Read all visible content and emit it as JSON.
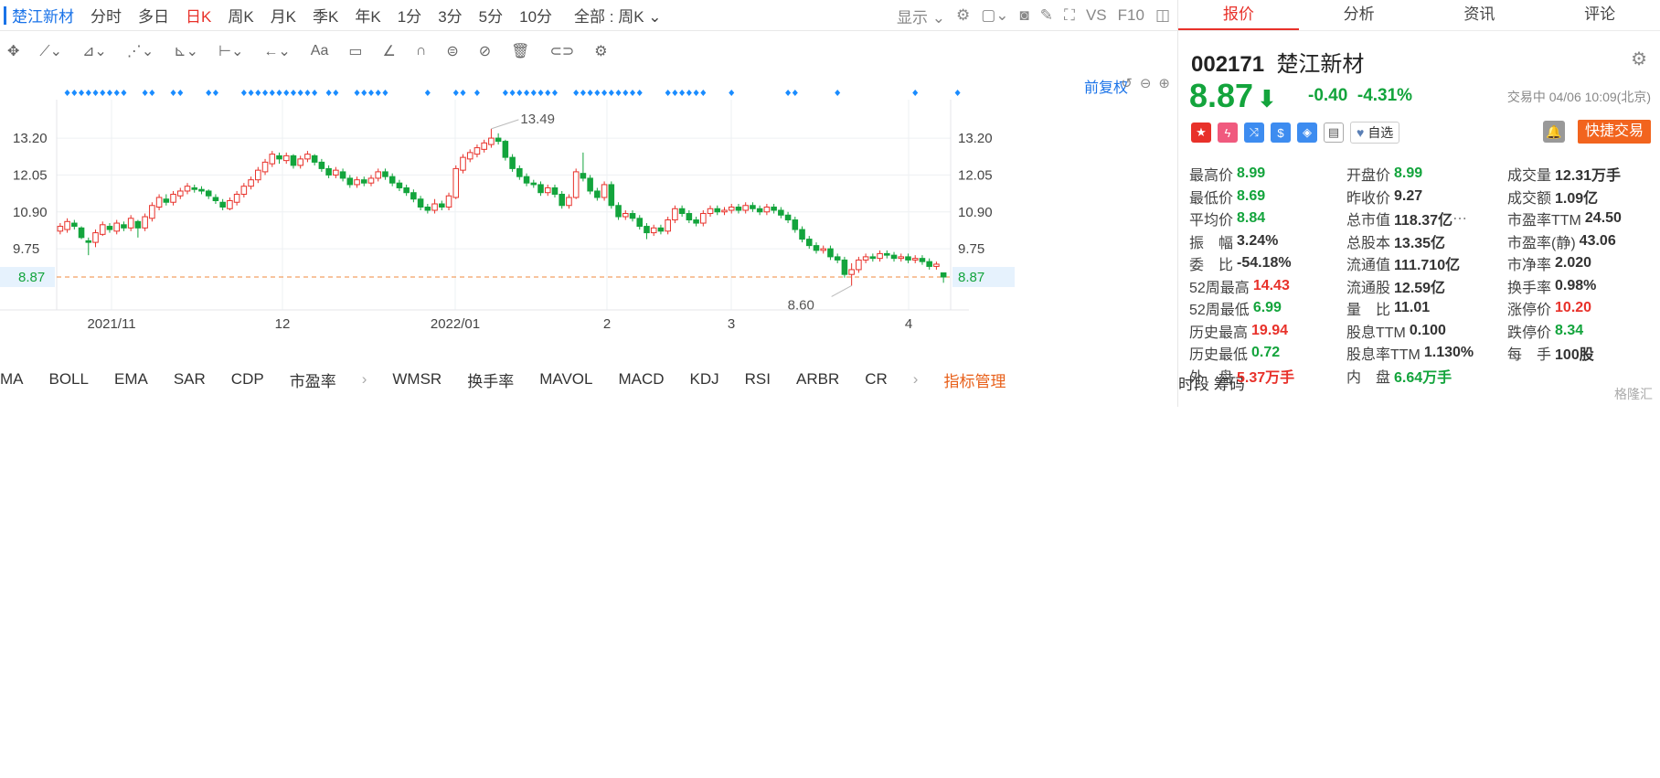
{
  "left_toolbar": {
    "stock_name": "楚江新材",
    "periods": [
      "分时",
      "多日",
      "日K",
      "周K",
      "月K",
      "季K",
      "年K",
      "1分",
      "3分",
      "5分",
      "10分"
    ],
    "active_period": "日K",
    "range_label": "全部 : 周K",
    "display_label": "显示",
    "vs_label": "VS",
    "f10_label": "F10"
  },
  "chart_header": {
    "fuquan_label": "前复权"
  },
  "chart_data": {
    "type": "candlestick",
    "y_ticks": [
      9.75,
      10.9,
      12.05,
      13.2
    ],
    "y_tick_labels": [
      "9.75",
      "10.90",
      "12.05",
      "13.20"
    ],
    "ylim": [
      8.3,
      14.0
    ],
    "x_tick_labels": [
      "2021/11",
      "12",
      "2022/01",
      "2",
      "3",
      "4"
    ],
    "current_price": 8.87,
    "current_price_label": "8.87",
    "high_label": "13.49",
    "low_label": "8.60",
    "candles": [
      {
        "o": 10.3,
        "c": 10.45,
        "h": 10.55,
        "l": 10.2
      },
      {
        "o": 10.35,
        "c": 10.6,
        "h": 10.7,
        "l": 10.25
      },
      {
        "o": 10.55,
        "c": 10.45,
        "h": 10.65,
        "l": 10.35
      },
      {
        "o": 10.4,
        "c": 10.1,
        "h": 10.45,
        "l": 10.05
      },
      {
        "o": 10.0,
        "c": 9.95,
        "h": 10.1,
        "l": 9.55
      },
      {
        "o": 9.95,
        "c": 10.25,
        "h": 10.35,
        "l": 9.8
      },
      {
        "o": 10.2,
        "c": 10.5,
        "h": 10.6,
        "l": 10.15
      },
      {
        "o": 10.45,
        "c": 10.35,
        "h": 10.55,
        "l": 10.25
      },
      {
        "o": 10.3,
        "c": 10.55,
        "h": 10.65,
        "l": 10.2
      },
      {
        "o": 10.5,
        "c": 10.4,
        "h": 10.6,
        "l": 10.3
      },
      {
        "o": 10.4,
        "c": 10.7,
        "h": 10.8,
        "l": 10.3
      },
      {
        "o": 10.6,
        "c": 10.4,
        "h": 10.65,
        "l": 10.1
      },
      {
        "o": 10.4,
        "c": 10.75,
        "h": 10.85,
        "l": 10.3
      },
      {
        "o": 10.7,
        "c": 11.1,
        "h": 11.2,
        "l": 10.6
      },
      {
        "o": 11.05,
        "c": 11.35,
        "h": 11.45,
        "l": 10.95
      },
      {
        "o": 11.3,
        "c": 11.2,
        "h": 11.45,
        "l": 11.1
      },
      {
        "o": 11.2,
        "c": 11.45,
        "h": 11.55,
        "l": 11.1
      },
      {
        "o": 11.4,
        "c": 11.55,
        "h": 11.65,
        "l": 11.3
      },
      {
        "o": 11.55,
        "c": 11.7,
        "h": 11.8,
        "l": 11.45
      },
      {
        "o": 11.65,
        "c": 11.6,
        "h": 11.75,
        "l": 11.5
      },
      {
        "o": 11.6,
        "c": 11.55,
        "h": 11.7,
        "l": 11.45
      },
      {
        "o": 11.55,
        "c": 11.4,
        "h": 11.6,
        "l": 11.3
      },
      {
        "o": 11.35,
        "c": 11.25,
        "h": 11.45,
        "l": 11.15
      },
      {
        "o": 11.2,
        "c": 11.05,
        "h": 11.3,
        "l": 10.95
      },
      {
        "o": 11.0,
        "c": 11.25,
        "h": 11.35,
        "l": 10.95
      },
      {
        "o": 11.2,
        "c": 11.45,
        "h": 11.55,
        "l": 11.1
      },
      {
        "o": 11.45,
        "c": 11.7,
        "h": 11.8,
        "l": 11.35
      },
      {
        "o": 11.7,
        "c": 11.9,
        "h": 12.0,
        "l": 11.6
      },
      {
        "o": 11.9,
        "c": 12.2,
        "h": 12.3,
        "l": 11.8
      },
      {
        "o": 12.15,
        "c": 12.45,
        "h": 12.55,
        "l": 12.05
      },
      {
        "o": 12.4,
        "c": 12.7,
        "h": 12.8,
        "l": 12.3
      },
      {
        "o": 12.65,
        "c": 12.55,
        "h": 12.75,
        "l": 12.4
      },
      {
        "o": 12.5,
        "c": 12.65,
        "h": 12.75,
        "l": 12.4
      },
      {
        "o": 12.65,
        "c": 12.35,
        "h": 12.7,
        "l": 12.25
      },
      {
        "o": 12.35,
        "c": 12.55,
        "h": 12.65,
        "l": 12.25
      },
      {
        "o": 12.55,
        "c": 12.7,
        "h": 12.8,
        "l": 12.45
      },
      {
        "o": 12.65,
        "c": 12.45,
        "h": 12.7,
        "l": 12.35
      },
      {
        "o": 12.45,
        "c": 12.25,
        "h": 12.55,
        "l": 12.15
      },
      {
        "o": 12.25,
        "c": 12.05,
        "h": 12.35,
        "l": 11.95
      },
      {
        "o": 12.05,
        "c": 12.2,
        "h": 12.3,
        "l": 11.95
      },
      {
        "o": 12.15,
        "c": 11.95,
        "h": 12.25,
        "l": 11.85
      },
      {
        "o": 11.95,
        "c": 11.75,
        "h": 12.05,
        "l": 11.65
      },
      {
        "o": 11.75,
        "c": 11.9,
        "h": 12.0,
        "l": 11.65
      },
      {
        "o": 11.9,
        "c": 11.8,
        "h": 12.0,
        "l": 11.7
      },
      {
        "o": 11.8,
        "c": 11.95,
        "h": 12.05,
        "l": 11.7
      },
      {
        "o": 11.95,
        "c": 12.15,
        "h": 12.25,
        "l": 11.85
      },
      {
        "o": 12.15,
        "c": 12.0,
        "h": 12.25,
        "l": 11.9
      },
      {
        "o": 12.0,
        "c": 11.8,
        "h": 12.1,
        "l": 11.7
      },
      {
        "o": 11.8,
        "c": 11.65,
        "h": 11.9,
        "l": 11.55
      },
      {
        "o": 11.65,
        "c": 11.5,
        "h": 11.75,
        "l": 11.4
      },
      {
        "o": 11.5,
        "c": 11.3,
        "h": 11.6,
        "l": 11.2
      },
      {
        "o": 11.3,
        "c": 11.05,
        "h": 11.4,
        "l": 10.95
      },
      {
        "o": 11.05,
        "c": 10.95,
        "h": 11.15,
        "l": 10.85
      },
      {
        "o": 10.95,
        "c": 11.15,
        "h": 11.3,
        "l": 10.85
      },
      {
        "o": 11.15,
        "c": 11.05,
        "h": 11.25,
        "l": 10.95
      },
      {
        "o": 11.05,
        "c": 11.4,
        "h": 11.5,
        "l": 10.95
      },
      {
        "o": 11.35,
        "c": 12.25,
        "h": 12.35,
        "l": 11.3
      },
      {
        "o": 12.2,
        "c": 12.6,
        "h": 12.7,
        "l": 12.1
      },
      {
        "o": 12.55,
        "c": 12.75,
        "h": 12.85,
        "l": 12.45
      },
      {
        "o": 12.7,
        "c": 12.9,
        "h": 13.0,
        "l": 12.6
      },
      {
        "o": 12.85,
        "c": 13.05,
        "h": 13.15,
        "l": 12.75
      },
      {
        "o": 13.0,
        "c": 13.2,
        "h": 13.49,
        "l": 12.9
      },
      {
        "o": 13.2,
        "c": 13.1,
        "h": 13.35,
        "l": 13.0
      },
      {
        "o": 13.1,
        "c": 12.6,
        "h": 13.15,
        "l": 12.5
      },
      {
        "o": 12.6,
        "c": 12.25,
        "h": 12.7,
        "l": 12.15
      },
      {
        "o": 12.25,
        "c": 12.0,
        "h": 12.35,
        "l": 11.9
      },
      {
        "o": 12.0,
        "c": 11.8,
        "h": 12.1,
        "l": 11.7
      },
      {
        "o": 11.8,
        "c": 11.75,
        "h": 11.9,
        "l": 11.65
      },
      {
        "o": 11.75,
        "c": 11.5,
        "h": 11.85,
        "l": 11.4
      },
      {
        "o": 11.5,
        "c": 11.65,
        "h": 11.75,
        "l": 11.4
      },
      {
        "o": 11.65,
        "c": 11.45,
        "h": 11.75,
        "l": 11.35
      },
      {
        "o": 11.45,
        "c": 11.1,
        "h": 11.55,
        "l": 11.0
      },
      {
        "o": 11.1,
        "c": 11.35,
        "h": 11.45,
        "l": 11.0
      },
      {
        "o": 11.35,
        "c": 12.15,
        "h": 12.25,
        "l": 11.3
      },
      {
        "o": 12.1,
        "c": 11.95,
        "h": 12.75,
        "l": 11.85
      },
      {
        "o": 11.95,
        "c": 11.55,
        "h": 12.05,
        "l": 11.45
      },
      {
        "o": 11.55,
        "c": 11.35,
        "h": 11.65,
        "l": 11.25
      },
      {
        "o": 11.35,
        "c": 11.75,
        "h": 11.85,
        "l": 11.25
      },
      {
        "o": 11.75,
        "c": 11.1,
        "h": 11.85,
        "l": 11.0
      },
      {
        "o": 11.1,
        "c": 10.75,
        "h": 11.2,
        "l": 10.65
      },
      {
        "o": 10.75,
        "c": 10.85,
        "h": 10.95,
        "l": 10.65
      },
      {
        "o": 10.85,
        "c": 10.7,
        "h": 10.95,
        "l": 10.6
      },
      {
        "o": 10.7,
        "c": 10.45,
        "h": 10.8,
        "l": 10.35
      },
      {
        "o": 10.45,
        "c": 10.25,
        "h": 10.55,
        "l": 10.05
      },
      {
        "o": 10.25,
        "c": 10.4,
        "h": 10.5,
        "l": 10.15
      },
      {
        "o": 10.4,
        "c": 10.3,
        "h": 10.5,
        "l": 10.2
      },
      {
        "o": 10.3,
        "c": 10.65,
        "h": 10.75,
        "l": 10.2
      },
      {
        "o": 10.65,
        "c": 11.0,
        "h": 11.1,
        "l": 10.55
      },
      {
        "o": 11.0,
        "c": 10.85,
        "h": 11.1,
        "l": 10.75
      },
      {
        "o": 10.85,
        "c": 10.65,
        "h": 10.95,
        "l": 10.55
      },
      {
        "o": 10.65,
        "c": 10.55,
        "h": 10.75,
        "l": 10.45
      },
      {
        "o": 10.55,
        "c": 10.85,
        "h": 10.95,
        "l": 10.45
      },
      {
        "o": 10.85,
        "c": 11.0,
        "h": 11.1,
        "l": 10.75
      },
      {
        "o": 11.0,
        "c": 10.9,
        "h": 11.1,
        "l": 10.8
      },
      {
        "o": 10.9,
        "c": 10.95,
        "h": 11.05,
        "l": 10.8
      },
      {
        "o": 10.95,
        "c": 11.05,
        "h": 11.15,
        "l": 10.85
      },
      {
        "o": 11.05,
        "c": 10.95,
        "h": 11.15,
        "l": 10.85
      },
      {
        "o": 10.95,
        "c": 11.1,
        "h": 11.2,
        "l": 10.85
      },
      {
        "o": 11.1,
        "c": 11.0,
        "h": 11.2,
        "l": 10.9
      },
      {
        "o": 11.0,
        "c": 10.9,
        "h": 11.1,
        "l": 10.8
      },
      {
        "o": 10.9,
        "c": 11.05,
        "h": 11.15,
        "l": 10.8
      },
      {
        "o": 11.05,
        "c": 10.95,
        "h": 11.15,
        "l": 10.85
      },
      {
        "o": 10.95,
        "c": 10.8,
        "h": 11.05,
        "l": 10.7
      },
      {
        "o": 10.8,
        "c": 10.65,
        "h": 10.9,
        "l": 10.55
      },
      {
        "o": 10.65,
        "c": 10.35,
        "h": 10.75,
        "l": 10.25
      },
      {
        "o": 10.35,
        "c": 10.05,
        "h": 10.45,
        "l": 9.95
      },
      {
        "o": 10.05,
        "c": 9.85,
        "h": 10.15,
        "l": 9.75
      },
      {
        "o": 9.85,
        "c": 9.7,
        "h": 9.95,
        "l": 9.6
      },
      {
        "o": 9.7,
        "c": 9.75,
        "h": 9.85,
        "l": 9.6
      },
      {
        "o": 9.75,
        "c": 9.5,
        "h": 9.85,
        "l": 9.4
      },
      {
        "o": 9.5,
        "c": 9.4,
        "h": 9.6,
        "l": 9.3
      },
      {
        "o": 9.4,
        "c": 8.95,
        "h": 9.5,
        "l": 8.85
      },
      {
        "o": 8.95,
        "c": 9.1,
        "h": 9.3,
        "l": 8.6
      },
      {
        "o": 9.1,
        "c": 9.4,
        "h": 9.5,
        "l": 9.0
      },
      {
        "o": 9.4,
        "c": 9.5,
        "h": 9.6,
        "l": 9.3
      },
      {
        "o": 9.5,
        "c": 9.45,
        "h": 9.6,
        "l": 9.35
      },
      {
        "o": 9.45,
        "c": 9.6,
        "h": 9.7,
        "l": 9.35
      },
      {
        "o": 9.6,
        "c": 9.55,
        "h": 9.7,
        "l": 9.45
      },
      {
        "o": 9.55,
        "c": 9.45,
        "h": 9.65,
        "l": 9.35
      },
      {
        "o": 9.45,
        "c": 9.5,
        "h": 9.6,
        "l": 9.35
      },
      {
        "o": 9.5,
        "c": 9.4,
        "h": 9.6,
        "l": 9.3
      },
      {
        "o": 9.4,
        "c": 9.45,
        "h": 9.55,
        "l": 9.3
      },
      {
        "o": 9.45,
        "c": 9.35,
        "h": 9.55,
        "l": 9.25
      },
      {
        "o": 9.35,
        "c": 9.2,
        "h": 9.45,
        "l": 9.1
      },
      {
        "o": 9.2,
        "c": 9.27,
        "h": 9.35,
        "l": 9.1
      },
      {
        "o": 9.0,
        "c": 8.87,
        "h": 8.99,
        "l": 8.69
      }
    ],
    "marker_groups": [
      [
        1,
        9
      ],
      [
        12,
        13
      ],
      [
        16,
        17
      ],
      [
        21,
        22
      ],
      [
        26,
        36
      ],
      [
        38,
        39
      ],
      [
        42,
        46
      ],
      [
        52
      ],
      [
        56,
        57
      ],
      [
        59
      ],
      [
        63,
        70
      ],
      [
        73,
        81
      ],
      [
        82
      ],
      [
        86,
        91
      ],
      [
        95
      ],
      [
        103,
        104
      ],
      [
        110
      ],
      [
        121
      ],
      [
        127
      ]
    ]
  },
  "indicator_bar": {
    "items_a": [
      "MA",
      "BOLL",
      "EMA",
      "SAR",
      "CDP",
      "市盈率"
    ],
    "items_b": [
      "WMSR",
      "换手率",
      "MAVOL",
      "MACD",
      "KDJ",
      "RSI",
      "ARBR",
      "CR"
    ],
    "manager_label": "指标管理",
    "right_label": "时段 筹码"
  },
  "right_panel": {
    "tabs": [
      "报价",
      "分析",
      "资讯",
      "评论"
    ],
    "code": "002171",
    "name": "楚江新材",
    "price": "8.87",
    "change": "-0.40",
    "change_pct": "-4.31%",
    "status": "交易中 04/06 10:09(北京)",
    "fav_label": "自选",
    "trade_label": "快捷交易",
    "rows": [
      [
        [
          "最高价",
          "8.99",
          "g"
        ],
        [
          "开盘价",
          "8.99",
          "g"
        ],
        [
          "成交量",
          "12.31万手",
          ""
        ]
      ],
      [
        [
          "最低价",
          "8.69",
          "g"
        ],
        [
          "昨收价",
          "9.27",
          ""
        ],
        [
          "成交额",
          "1.09亿",
          ""
        ]
      ],
      [
        [
          "平均价",
          "8.84",
          "g"
        ],
        [
          "总市值",
          "118.37亿",
          ""
        ],
        [
          "市盈率TTM",
          "24.50",
          ""
        ]
      ],
      [
        [
          "振　幅",
          "3.24%",
          ""
        ],
        [
          "总股本",
          "13.35亿",
          ""
        ],
        [
          "市盈率(静)",
          "43.06",
          ""
        ]
      ],
      [
        [
          "委　比",
          "-54.18%",
          ""
        ],
        [
          "流通值",
          "111.710亿",
          ""
        ],
        [
          "市净率",
          "2.020",
          ""
        ]
      ],
      [
        [
          "52周最高",
          "14.43",
          "r"
        ],
        [
          "流通股",
          "12.59亿",
          ""
        ],
        [
          "换手率",
          "0.98%",
          ""
        ]
      ],
      [
        [
          "52周最低",
          "6.99",
          "g"
        ],
        [
          "量　比",
          "11.01",
          ""
        ],
        [
          "涨停价",
          "10.20",
          "r"
        ]
      ],
      [
        [
          "历史最高",
          "19.94",
          "r"
        ],
        [
          "股息TTM",
          "0.100",
          ""
        ],
        [
          "跌停价",
          "8.34",
          "g"
        ]
      ],
      [
        [
          "历史最低",
          "0.72",
          "g"
        ],
        [
          "股息率TTM",
          "1.130%",
          ""
        ],
        [
          "每　手",
          "100股",
          ""
        ]
      ],
      [
        [
          "外　盘",
          "5.37万手",
          "r"
        ],
        [
          "内　盘",
          "6.64万手",
          "g"
        ],
        [
          "",
          "",
          " "
        ]
      ]
    ],
    "watermark": "格隆汇"
  },
  "colors": {
    "up": "#e8312a",
    "down": "#13a43c",
    "accent": "#1a73e8",
    "marker": "#1a8cff",
    "current_line": "#f08a3c"
  }
}
